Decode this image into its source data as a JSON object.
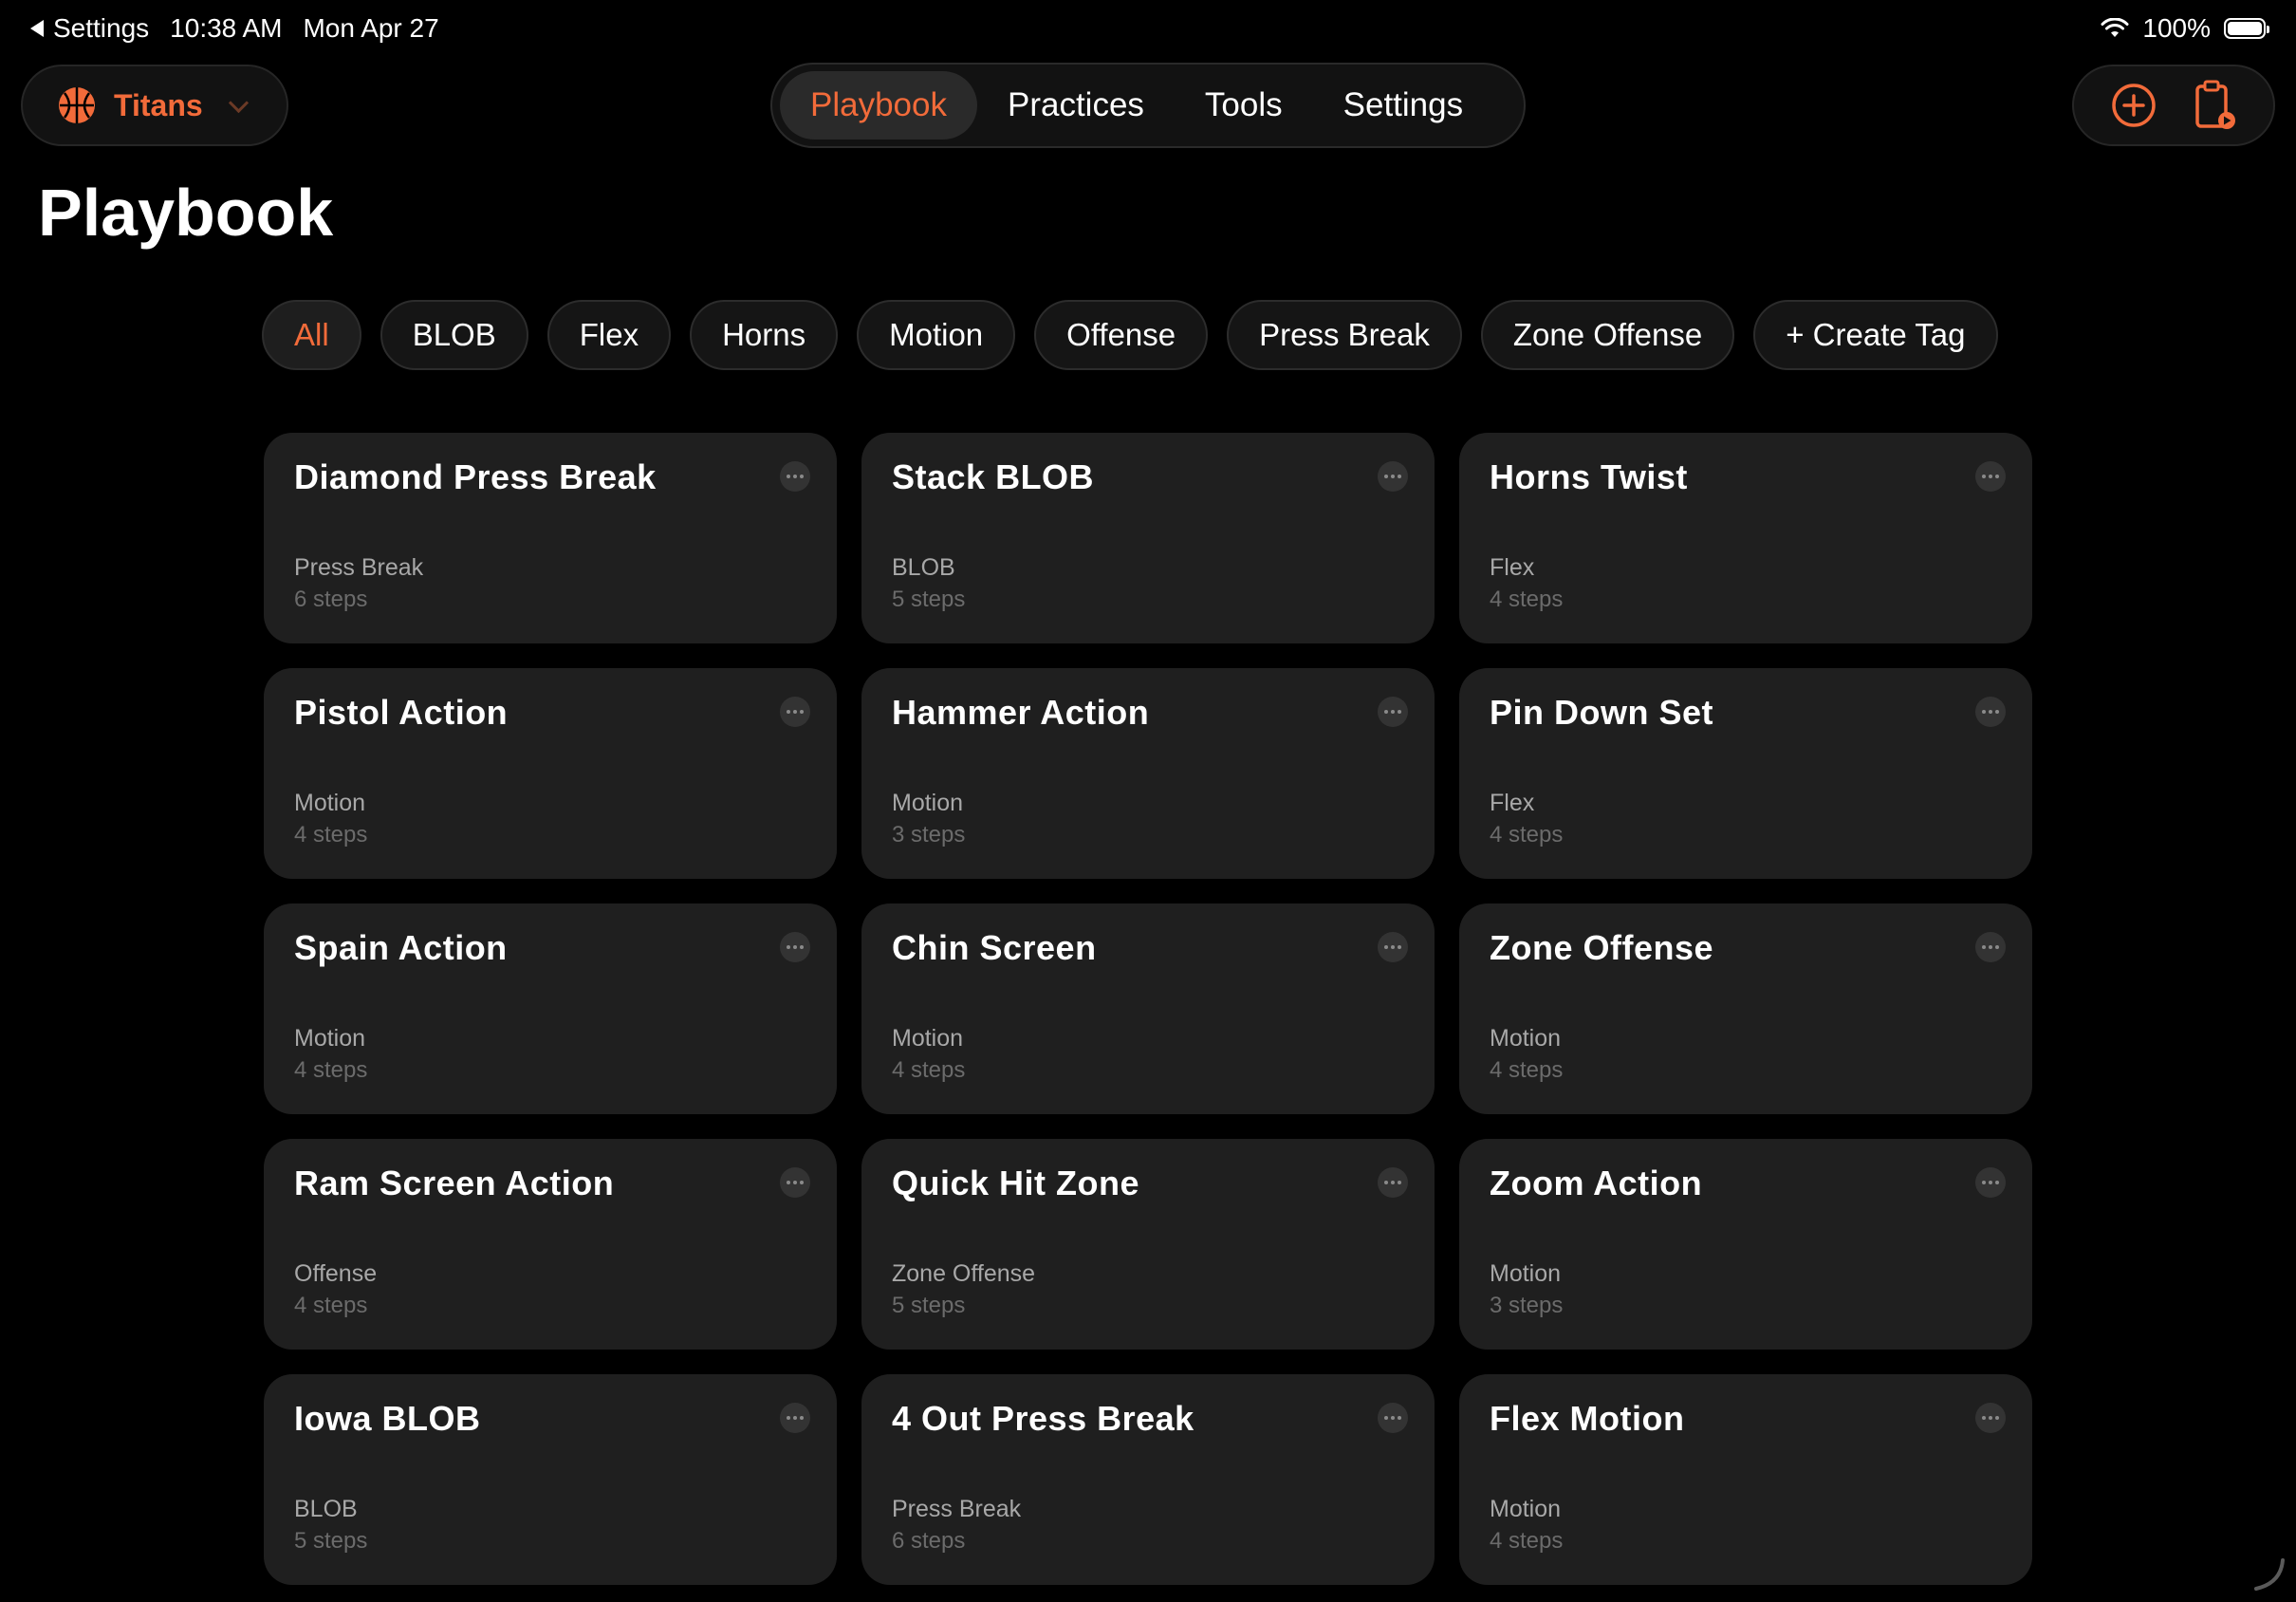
{
  "status_bar": {
    "back_label": "Settings",
    "time": "10:38 AM",
    "date": "Mon Apr 27",
    "battery": "100%"
  },
  "team": {
    "name": "Titans",
    "icon": "basketball-icon"
  },
  "nav": {
    "tabs": [
      {
        "label": "Playbook",
        "active": true
      },
      {
        "label": "Practices",
        "active": false
      },
      {
        "label": "Tools",
        "active": false
      },
      {
        "label": "Settings",
        "active": false
      }
    ]
  },
  "actions": {
    "add_icon": "plus-circle-icon",
    "clipboard_icon": "clipboard-play-icon"
  },
  "page": {
    "title": "Playbook"
  },
  "tags": [
    "All",
    "BLOB",
    "Flex",
    "Horns",
    "Motion",
    "Offense",
    "Press Break",
    "Zone Offense",
    "+ Create Tag"
  ],
  "plays": [
    {
      "title": "Diamond Press Break",
      "tag": "Press Break",
      "steps": "6 steps"
    },
    {
      "title": "Stack BLOB",
      "tag": "BLOB",
      "steps": "5 steps"
    },
    {
      "title": "Horns Twist",
      "tag": "Flex",
      "steps": "4 steps"
    },
    {
      "title": "Pistol Action",
      "tag": "Motion",
      "steps": "4 steps"
    },
    {
      "title": "Hammer Action",
      "tag": "Motion",
      "steps": "3 steps"
    },
    {
      "title": "Pin Down Set",
      "tag": "Flex",
      "steps": "4 steps"
    },
    {
      "title": "Spain Action",
      "tag": "Motion",
      "steps": "4 steps"
    },
    {
      "title": "Chin Screen",
      "tag": "Motion",
      "steps": "4 steps"
    },
    {
      "title": "Zone Offense",
      "tag": "Motion",
      "steps": "4 steps"
    },
    {
      "title": "Ram Screen Action",
      "tag": "Offense",
      "steps": "4 steps"
    },
    {
      "title": "Quick Hit Zone",
      "tag": "Zone Offense",
      "steps": "5 steps"
    },
    {
      "title": "Zoom Action",
      "tag": "Motion",
      "steps": "3 steps"
    },
    {
      "title": "Iowa BLOB",
      "tag": "BLOB",
      "steps": "5 steps"
    },
    {
      "title": "4 Out Press Break",
      "tag": "Press Break",
      "steps": "6 steps"
    },
    {
      "title": "Flex Motion",
      "tag": "Motion",
      "steps": "4 steps"
    }
  ],
  "colors": {
    "accent": "#F26B3A",
    "card": "#1f1f1f",
    "background": "#000000"
  }
}
